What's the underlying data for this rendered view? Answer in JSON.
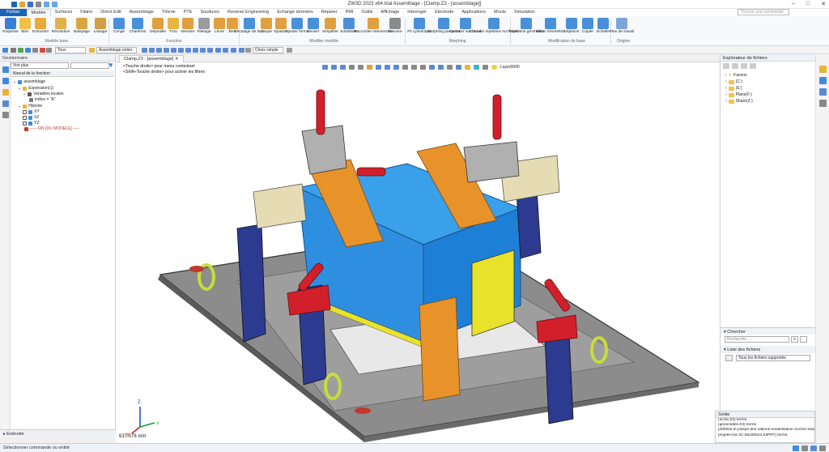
{
  "window": {
    "title": "ZW3D 2023 x64 trial    Assemblage - [Clamp.Z3 - [assemblage]]"
  },
  "menu": {
    "items": [
      "Fichier",
      "Modèle",
      "Surfaces",
      "Filaire",
      "Direct Edit",
      "Assemblage",
      "Tôlerie",
      "PTE",
      "Soudures",
      "Reverse Engineering",
      "Echange données",
      "Réparer",
      "PMI",
      "Outils",
      "Affichage",
      "Interroger",
      "Electrode",
      "Applications",
      "Moule",
      "Simulation"
    ],
    "search_placeholder": "Trouver une commande"
  },
  "ribbon": {
    "buttons": [
      {
        "label": "Esquisse",
        "icon": "sketch-icon"
      },
      {
        "label": "Bloc",
        "icon": "block-icon"
      },
      {
        "label": "Extrusion",
        "icon": "extrude-icon"
      },
      {
        "label": "Révolution",
        "icon": "revolve-icon"
      },
      {
        "label": "Balayage",
        "icon": "sweep-icon"
      },
      {
        "label": "Lissage",
        "icon": "loft-icon"
      },
      {
        "label": "Congé",
        "icon": "fillet-icon"
      },
      {
        "label": "Chanfrein",
        "icon": "chamfer-icon"
      },
      {
        "label": "Dépouille",
        "icon": "draft-icon"
      },
      {
        "label": "Trou",
        "icon": "hole-icon"
      },
      {
        "label": "Nervure",
        "icon": "rib-icon"
      },
      {
        "label": "Filetage",
        "icon": "thread-icon"
      },
      {
        "label": "Lèvre",
        "icon": "lip-icon"
      },
      {
        "label": "Brut",
        "icon": "stock-icon"
      },
      {
        "label": "Décalage de face",
        "icon": "offset-icon"
      },
      {
        "label": "Coque",
        "icon": "shell-icon"
      },
      {
        "label": "Epaissir",
        "icon": "thicken-icon"
      },
      {
        "label": "Ajouter forme",
        "icon": "add-shape-icon"
      },
      {
        "label": "Diviser",
        "icon": "split-icon"
      },
      {
        "label": "Simplifier",
        "icon": "simplify-icon"
      },
      {
        "label": "Substituer",
        "icon": "replace-icon"
      },
      {
        "label": "Raccorder intersection",
        "icon": "intersect-icon"
      },
      {
        "label": "Gravure",
        "icon": "engrave-icon"
      },
      {
        "label": "Pli cylindrique",
        "icon": "cyl-fold-icon"
      },
      {
        "label": "Morphing par point",
        "icon": "morph-icon"
      },
      {
        "label": "Enrouler sur faces",
        "icon": "wrap-icon"
      },
      {
        "label": "Enrouler répétition sur faces",
        "icon": "wrap-pattern-icon"
      },
      {
        "label": "Répétition géométrie",
        "icon": "pattern-icon"
      },
      {
        "label": "Miroir Géométrie",
        "icon": "mirror-icon"
      },
      {
        "label": "Déplacer",
        "icon": "move-icon"
      },
      {
        "label": "Copier",
        "icon": "copy-icon"
      },
      {
        "label": "Echelle",
        "icon": "scale-icon"
      },
      {
        "label": "Plan de travail",
        "icon": "workplane-icon"
      }
    ],
    "groups": [
      "Modèle base",
      "Fonction",
      "Modifier modèle",
      "Morphing",
      "Modification de base",
      "Origine"
    ]
  },
  "toolbar2": {
    "filter": "Tous",
    "assembly": "Assemblage entier",
    "pick": "Choix simple"
  },
  "manager": {
    "title": "Gestionnaire",
    "view_combo": "Voir plus",
    "column": "Noeud de la fonction",
    "tree": [
      "assemblage",
      "Expression(1)",
      "Variables locales",
      "indice = \"A\"",
      "Historie",
      "XY",
      "XZ",
      "YZ",
      "----- FIN [DU MODELE] -----"
    ],
    "footer": "Exécuter"
  },
  "viewport": {
    "tab": "Clamp.Z3 - [assemblage]",
    "hint1": "<Touche droite> pour menu contextuel",
    "hint2": "<Shift+Touche droite> pour activer les filtres",
    "layer": "Layer0000",
    "scale": "637.076 mm",
    "axes": {
      "x": "X",
      "y": "Y",
      "z": "Z"
    }
  },
  "explorer": {
    "title": "Explorateur de fichiers",
    "items": [
      "Favoris",
      "(C:)",
      "(E:)",
      "Plans(F:)",
      "Share(Z:)"
    ],
    "search_title": "Chercher",
    "search_placeholder": "Recherche ...",
    "list_title": "Liste des fichiers",
    "filter": "Tous les fichiers supportés"
  },
  "output": {
    "title": "Sortie",
    "lines": [
      "(niche.Z3) fermé.",
      "(généralités.Z3) fermé.",
      "[200922-st joseph des nations-modélisation clocher-état",
      "projeté-indi 3C-05180524.Z3PRT] fermé."
    ]
  },
  "status": {
    "text": "Sélectionner commande ou entité"
  },
  "colors": {
    "accent": "#1b63b9",
    "part_blue": "#2e8fe0",
    "part_orange": "#e8922a",
    "part_red": "#d2202a",
    "part_yellow": "#e8e22a",
    "part_navy": "#2c3a8f",
    "part_tan": "#e6dcb4",
    "plate": "#8c8c8c"
  }
}
